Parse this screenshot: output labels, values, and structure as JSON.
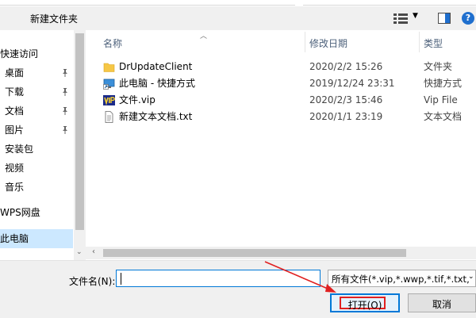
{
  "toolbar": {
    "new_folder_label": "新建文件夹",
    "view_icon": "view-options-icon",
    "preview_icon": "preview-pane-icon",
    "help_icon": "help-icon",
    "help_glyph": "?"
  },
  "nav": {
    "items": [
      {
        "label": "快速访问",
        "pinned": false
      },
      {
        "label": "桌面",
        "pinned": true
      },
      {
        "label": "下载",
        "pinned": true
      },
      {
        "label": "文档",
        "pinned": true
      },
      {
        "label": "图片",
        "pinned": true
      },
      {
        "label": "安装包",
        "pinned": false
      },
      {
        "label": "视频",
        "pinned": false
      },
      {
        "label": "音乐",
        "pinned": false
      },
      {
        "label": "WPS网盘",
        "pinned": false
      },
      {
        "label": "此电脑",
        "pinned": false,
        "selected": true
      }
    ]
  },
  "columns": {
    "name": "名称",
    "date": "修改日期",
    "type": "类型"
  },
  "files": [
    {
      "name": "DrUpdateClient",
      "date": "2020/2/2 15:26",
      "type": "文件夹",
      "icon": "folder-icon"
    },
    {
      "name": "此电脑 - 快捷方式",
      "date": "2019/12/24 23:31",
      "type": "快捷方式",
      "icon": "shortcut-icon"
    },
    {
      "name": "文件.vip",
      "date": "2020/2/3 15:46",
      "type": "Vip File",
      "icon": "vip-file-icon"
    },
    {
      "name": "新建文本文档.txt",
      "date": "2020/1/1 23:19",
      "type": "文本文档",
      "icon": "text-file-icon"
    }
  ],
  "bottom": {
    "filename_label": "文件名(N):",
    "filename_value": "",
    "filetype_selected": "所有文件(*.vip,*.wwp,*.tif,*.txt,",
    "open_label": "打开(O)",
    "cancel_label": "取消"
  },
  "colors": {
    "accent": "#0078d7",
    "highlight_red": "#e02020",
    "selection": "#cce8ff",
    "folder": "#f6c746"
  }
}
